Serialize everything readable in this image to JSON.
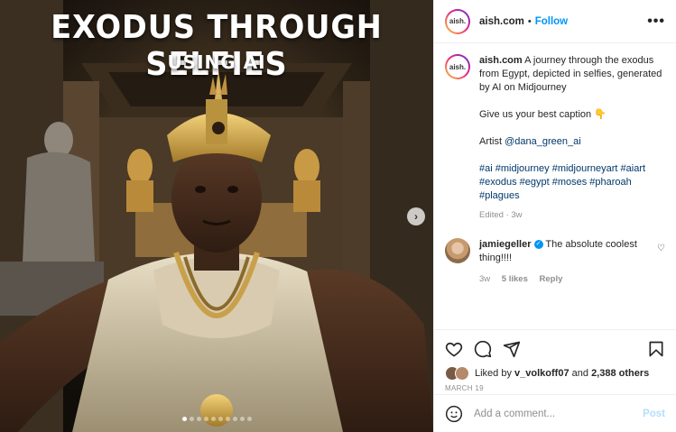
{
  "image": {
    "title": "EXODUS THROUGH SELFIES",
    "subtitle": "USING AI",
    "next_icon": "chevron-right-icon",
    "slide_count": 10,
    "active_slide": 1
  },
  "header": {
    "username": "aish.com",
    "separator": "•",
    "follow_label": "Follow",
    "more_icon": "•••",
    "avatar_text": "aish."
  },
  "caption": {
    "username": "aish.com",
    "text": "A journey through the exodus from Egypt, depicted in selfies, generated by AI on Midjourney",
    "line2": "Give us your best caption 👇",
    "artist_label": "Artist",
    "artist_handle": "@dana_green_ai",
    "hashtags": "#ai #midjourney #midjourneyart #aiart #exodus #egypt #moses #pharoah #plagues",
    "meta": "Edited · 3w"
  },
  "comment": {
    "username": "jamiegeller",
    "verified_mark": "✓",
    "text": "The absolute coolest thing!!!!",
    "time": "3w",
    "likes": "5 likes",
    "reply": "Reply",
    "heart_icon": "♡"
  },
  "actions": {
    "liked_by_prefix": "Liked by",
    "liked_by_user": "v_volkoff07",
    "and_label": "and",
    "others_count": "2,388",
    "others_label": "others",
    "date": "MARCH 19"
  },
  "add_comment": {
    "placeholder": "Add a comment...",
    "post_label": "Post"
  },
  "colors": {
    "accent": "#0095f6",
    "post_disabled": "#b2dffc",
    "muted": "#8e8e8e"
  }
}
